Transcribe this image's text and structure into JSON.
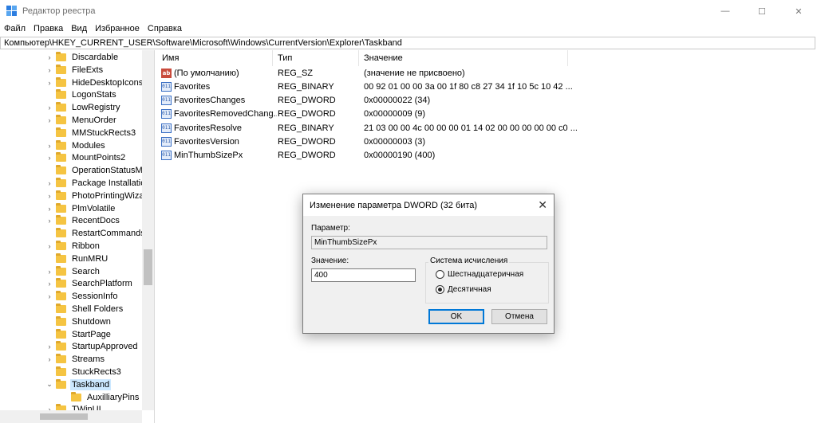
{
  "window": {
    "title": "Редактор реестра",
    "min_glyph": "—",
    "max_glyph": "☐",
    "close_glyph": "✕"
  },
  "menu": [
    "Файл",
    "Правка",
    "Вид",
    "Избранное",
    "Справка"
  ],
  "address": "Компьютер\\HKEY_CURRENT_USER\\Software\\Microsoft\\Windows\\CurrentVersion\\Explorer\\Taskband",
  "tree": {
    "items": [
      {
        "label": "Discardable",
        "expander": "›"
      },
      {
        "label": "FileExts",
        "expander": "›"
      },
      {
        "label": "HideDesktopIcons",
        "expander": "›"
      },
      {
        "label": "LogonStats",
        "expander": ""
      },
      {
        "label": "LowRegistry",
        "expander": "›"
      },
      {
        "label": "MenuOrder",
        "expander": "›"
      },
      {
        "label": "MMStuckRects3",
        "expander": ""
      },
      {
        "label": "Modules",
        "expander": "›"
      },
      {
        "label": "MountPoints2",
        "expander": "›"
      },
      {
        "label": "OperationStatusMa",
        "expander": ""
      },
      {
        "label": "Package Installatio",
        "expander": "›"
      },
      {
        "label": "PhotoPrintingWizar",
        "expander": "›"
      },
      {
        "label": "PlmVolatile",
        "expander": "›"
      },
      {
        "label": "RecentDocs",
        "expander": "›"
      },
      {
        "label": "RestartCommands",
        "expander": ""
      },
      {
        "label": "Ribbon",
        "expander": "›"
      },
      {
        "label": "RunMRU",
        "expander": ""
      },
      {
        "label": "Search",
        "expander": "›"
      },
      {
        "label": "SearchPlatform",
        "expander": "›"
      },
      {
        "label": "SessionInfo",
        "expander": "›"
      },
      {
        "label": "Shell Folders",
        "expander": ""
      },
      {
        "label": "Shutdown",
        "expander": ""
      },
      {
        "label": "StartPage",
        "expander": ""
      },
      {
        "label": "StartupApproved",
        "expander": "›"
      },
      {
        "label": "Streams",
        "expander": "›"
      },
      {
        "label": "StuckRects3",
        "expander": ""
      },
      {
        "label": "Taskband",
        "expander": "⌄",
        "selected": true
      },
      {
        "label": "AuxilliaryPins",
        "expander": "",
        "child": true
      },
      {
        "label": "TWinUI",
        "expander": "›"
      }
    ]
  },
  "values": {
    "columns": [
      "Имя",
      "Тип",
      "Значение"
    ],
    "rows": [
      {
        "icon": "string-value-icon",
        "name": "(По умолчанию)",
        "type": "REG_SZ",
        "data": "(значение не присвоено)"
      },
      {
        "icon": "binary-value-icon",
        "name": "Favorites",
        "type": "REG_BINARY",
        "data": "00 92 01 00 00 3a 00 1f 80 c8 27 34 1f 10 5c 10 42 ..."
      },
      {
        "icon": "binary-value-icon",
        "name": "FavoritesChanges",
        "type": "REG_DWORD",
        "data": "0x00000022 (34)"
      },
      {
        "icon": "binary-value-icon",
        "name": "FavoritesRemovedChang...",
        "type": "REG_DWORD",
        "data": "0x00000009 (9)"
      },
      {
        "icon": "binary-value-icon",
        "name": "FavoritesResolve",
        "type": "REG_BINARY",
        "data": "21 03 00 00 4c 00 00 00 01 14 02 00 00 00 00 00 c0 ..."
      },
      {
        "icon": "binary-value-icon",
        "name": "FavoritesVersion",
        "type": "REG_DWORD",
        "data": "0x00000003 (3)"
      },
      {
        "icon": "binary-value-icon",
        "name": "MinThumbSizePx",
        "type": "REG_DWORD",
        "data": "0x00000190 (400)"
      }
    ],
    "icon_text": {
      "string": "ab",
      "binary": "011"
    }
  },
  "dialog": {
    "title": "Изменение параметра DWORD (32 бита)",
    "close_glyph": "✕",
    "param_label": "Параметр:",
    "param_value": "MinThumbSizePx",
    "value_label": "Значение:",
    "value_input": "400",
    "base_group_title": "Система исчисления",
    "radio_hex": "Шестнадцатеричная",
    "radio_dec": "Десятичная",
    "selected_base": "decimal",
    "ok_label": "OK",
    "cancel_label": "Отмена"
  },
  "colors": {
    "selection": "#cce8ff",
    "default_button_border": "#0078d7",
    "folder": "#f5c442"
  }
}
